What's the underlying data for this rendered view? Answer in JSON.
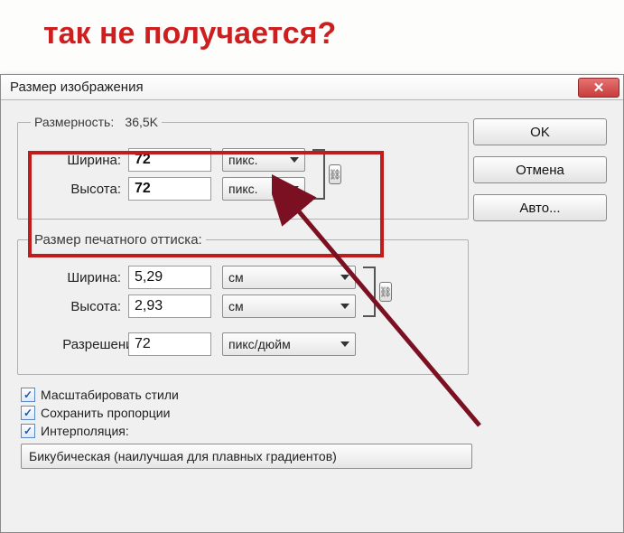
{
  "annotation": "так не получается?",
  "window": {
    "title": "Размер изображения"
  },
  "buttons": {
    "ok": "OK",
    "cancel": "Отмена",
    "auto": "Авто..."
  },
  "pixeldim": {
    "legend_label": "Размерность:",
    "legend_value": "36,5K",
    "width_label": "Ширина:",
    "width_value": "72",
    "width_unit": "пикс.",
    "height_label": "Высота:",
    "height_value": "72",
    "height_unit": "пикс."
  },
  "printdim": {
    "legend": "Размер печатного оттиска:",
    "width_label": "Ширина:",
    "width_value": "5,29",
    "width_unit": "см",
    "height_label": "Высота:",
    "height_value": "2,93",
    "height_unit": "см",
    "res_label": "Разрешение:",
    "res_value": "72",
    "res_unit": "пикс/дюйм"
  },
  "checks": {
    "scale_styles": "Масштабировать стили",
    "constrain": "Сохранить пропорции",
    "resample": "Интерполяция:"
  },
  "resample_method": "Бикубическая (наилучшая для плавных градиентов)"
}
